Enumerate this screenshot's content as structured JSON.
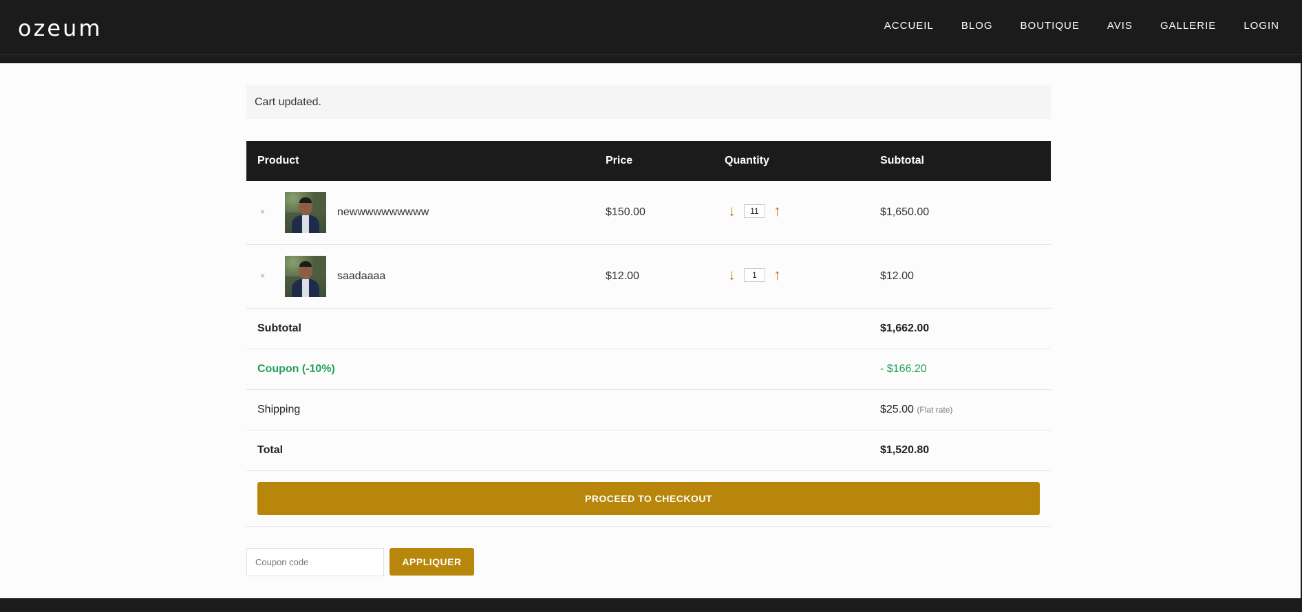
{
  "header": {
    "logo": "ozeum",
    "nav": [
      "ACCUEIL",
      "BLOG",
      "BOUTIQUE",
      "AVIS",
      "GALLERIE",
      "LOGIN"
    ]
  },
  "notice": "Cart updated.",
  "table": {
    "headers": {
      "product": "Product",
      "price": "Price",
      "quantity": "Quantity",
      "subtotal": "Subtotal"
    },
    "rows": [
      {
        "remove": "×",
        "name": "newwwwwwwwww",
        "price": "$150.00",
        "qty": "11",
        "subtotal": "$1,650.00"
      },
      {
        "remove": "×",
        "name": "saadaaaa",
        "price": "$12.00",
        "qty": "1",
        "subtotal": "$12.00"
      }
    ],
    "qty_down": "↓",
    "qty_up": "↑"
  },
  "totals": {
    "subtotal_label": "Subtotal",
    "subtotal_value": "$1,662.00",
    "coupon_label": "Coupon (-10%)",
    "coupon_value": "- $166.20",
    "shipping_label": "Shipping",
    "shipping_value": "$25.00",
    "shipping_method": "(Flat rate)",
    "total_label": "Total",
    "total_value": "$1,520.80"
  },
  "checkout_label": "PROCEED TO CHECKOUT",
  "coupon_form": {
    "placeholder": "Coupon code",
    "apply_label": "APPLIQUER"
  },
  "colors": {
    "accent": "#b8860b",
    "header_bg": "#1b1b1b",
    "coupon_green": "#22a05a"
  }
}
